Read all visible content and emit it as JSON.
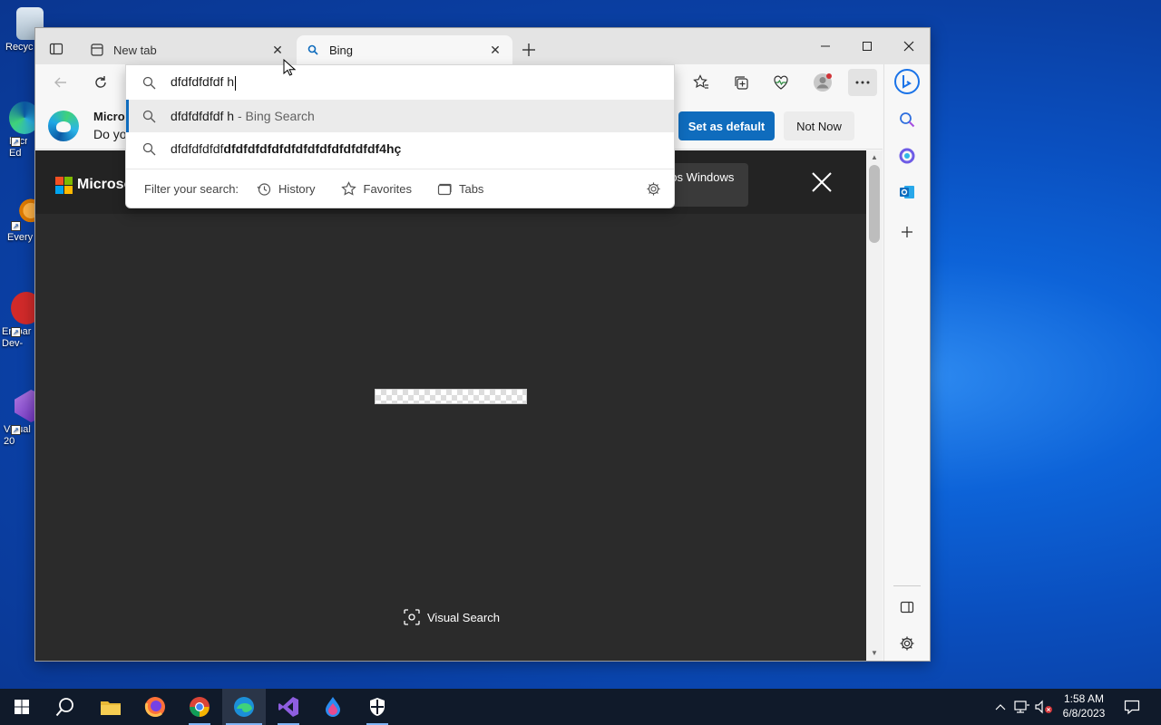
{
  "desktop": {
    "icons": [
      {
        "label": "Recyc",
        "icon": "recycle-bin-icon"
      },
      {
        "label": "Micro Ed",
        "icon": "edge-shortcut-icon"
      },
      {
        "label": "Every",
        "icon": "everything-search-icon"
      },
      {
        "label": "Embar Dev-",
        "icon": "embarcadero-dev-cpp-icon"
      },
      {
        "label": "Visual 20",
        "icon": "visual-studio-icon"
      }
    ]
  },
  "browser": {
    "tabs": [
      {
        "title": "New tab",
        "icon": "new-tab-icon",
        "active": false
      },
      {
        "title": "Bing",
        "icon": "bing-search-icon",
        "active": true
      }
    ],
    "address": {
      "query": "dfdfdfdfdf h"
    },
    "suggestions": [
      {
        "main": "dfdfdfdfdf h",
        "secondary": " - Bing Search",
        "selected": true
      },
      {
        "prefix": "dfdfdfdfdf",
        "bold": "dfdfdfdfdfdfdfdfdfdfdfdfdf4hç",
        "selected": false
      }
    ],
    "filter": {
      "label": "Filter your search:",
      "options": [
        "History",
        "Favorites",
        "Tabs"
      ]
    },
    "infobar": {
      "title": "Micros",
      "text": "Do yo",
      "set_default": "Set as default",
      "not_now": "Not Now"
    },
    "page": {
      "brand": "Microsof",
      "promo": "ros Windows",
      "visual_search": "Visual Search"
    }
  },
  "taskbar": {
    "time": "1:58 AM",
    "date": "6/8/2023",
    "apps": [
      "start-icon",
      "search-icon",
      "file-explorer-icon",
      "firefox-icon",
      "chrome-icon",
      "edge-icon",
      "visual-studio-icon",
      "paint-icon",
      "defender-icon"
    ]
  },
  "colors": {
    "accent": "#0f6cbd",
    "page_bg": "#2b2b2b",
    "taskbar": "#101a2a"
  }
}
